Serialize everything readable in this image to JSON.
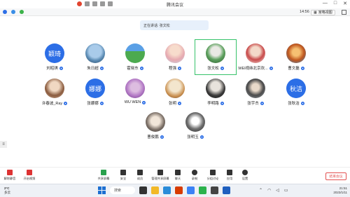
{
  "window": {
    "title": "腾讯会议",
    "time": "14:56",
    "gallery_label": "宫格视图"
  },
  "banner": {
    "text": "正在讲话: 张文松"
  },
  "participants": [
    {
      "name": "刘昭琪",
      "avatar_text": "颖琦",
      "type": "text"
    },
    {
      "name": "朱日超",
      "type": "photo1"
    },
    {
      "name": "霍晓东",
      "type": "photo2"
    },
    {
      "name": "程强",
      "type": "photo3"
    },
    {
      "name": "张文松",
      "type": "photo4",
      "active": true
    },
    {
      "name": "WEI视纬北京欢...",
      "type": "photo5"
    },
    {
      "name": "曹文磊",
      "type": "photo6"
    },
    {
      "name": "许春波_Ray",
      "type": "photo7"
    },
    {
      "name": "张娜娜",
      "avatar_text": "娜娜",
      "type": "text"
    },
    {
      "name": "WU WEN",
      "type": "photo8"
    },
    {
      "name": "张明",
      "type": "photo9"
    },
    {
      "name": "李明路",
      "type": "photo10"
    },
    {
      "name": "张宇杰",
      "type": "photo11"
    },
    {
      "name": "张秋洁",
      "avatar_text": "秋洁",
      "type": "text"
    },
    {
      "name": "曹俊鹏",
      "type": "photo12"
    },
    {
      "name": "张明玉",
      "type": "photo13"
    }
  ],
  "controls": [
    {
      "label": "解除静音",
      "red": true
    },
    {
      "label": "开启视频",
      "red": true
    },
    {
      "label": "共享屏幕"
    },
    {
      "label": "安全"
    },
    {
      "label": "成员"
    },
    {
      "label": "管理共享屏幕"
    },
    {
      "label": "聊天"
    },
    {
      "label": "录制"
    },
    {
      "label": "分组讨论"
    },
    {
      "label": "应用"
    },
    {
      "label": "设置"
    }
  ],
  "leave_label": "结束会议",
  "taskbar": {
    "weather_temp": "2°C",
    "weather_desc": "多云",
    "search_label": "搜索",
    "clock_time": "21:51",
    "clock_date": "2023/1/11"
  }
}
